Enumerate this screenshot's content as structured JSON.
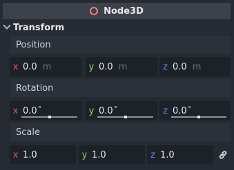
{
  "node": {
    "title": "Node3D",
    "icon": "node3d-circle-icon",
    "icon_color": "#fc7f7f"
  },
  "section": {
    "title": "Transform"
  },
  "position": {
    "label": "Position",
    "x": {
      "axis": "x",
      "value": "0.0",
      "unit": "m"
    },
    "y": {
      "axis": "y",
      "value": "0.0",
      "unit": "m"
    },
    "z": {
      "axis": "z",
      "value": "0.0",
      "unit": "m"
    }
  },
  "rotation": {
    "label": "Rotation",
    "x": {
      "axis": "x",
      "value": "0.0",
      "unit": "°"
    },
    "y": {
      "axis": "y",
      "value": "0.0",
      "unit": "°"
    },
    "z": {
      "axis": "z",
      "value": "0.0",
      "unit": "°"
    }
  },
  "scale": {
    "label": "Scale",
    "x": {
      "axis": "x",
      "value": "1.0"
    },
    "y": {
      "axis": "y",
      "value": "1.0"
    },
    "z": {
      "axis": "z",
      "value": "1.0"
    },
    "link_icon": "link-icon"
  },
  "colors": {
    "x": "#e05a58",
    "y": "#8ad84e",
    "z": "#5a8ce6"
  }
}
